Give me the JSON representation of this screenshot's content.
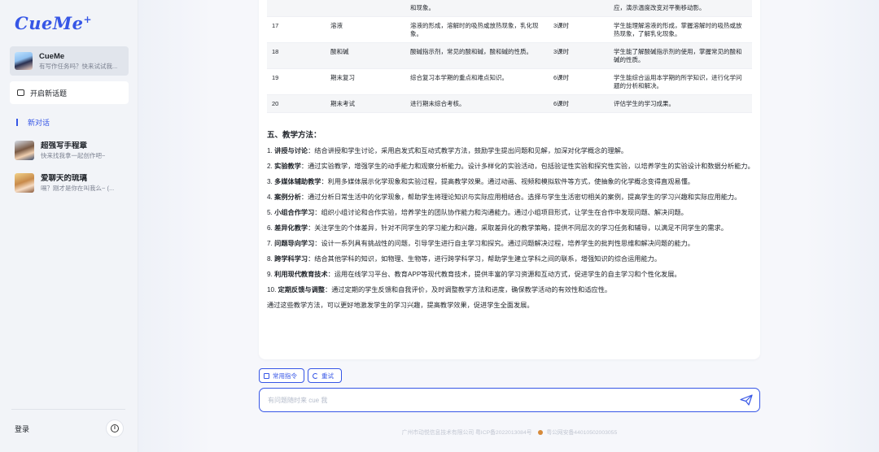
{
  "sidebar": {
    "logo": "CueMe",
    "bot_card": {
      "title": "CueMe",
      "subtitle": "有写作任务吗？快来试试我..."
    },
    "new_topic_label": "开启新话题",
    "new_chat_label": "新对话",
    "history": [
      {
        "title": "超强写手程章",
        "subtitle": "快来找我拿一起创作吧~"
      },
      {
        "title": "爱聊天的琉璃",
        "subtitle": "嗝？刚才是你在叫我么~ (..."
      }
    ],
    "login_label": "登录"
  },
  "table": {
    "partial_row": {
      "c3": "和现象。",
      "c5": "应，演示温度改变对平衡移动影。"
    },
    "rows": [
      {
        "no": "17",
        "topic": "溶液",
        "content": "溶液的形成，溶解时的吸热或放热现象，乳化现象。",
        "hours": "3课时",
        "goal": "学生能理解溶液的形成，掌握溶解时的吸热或放热现象，了解乳化现象。"
      },
      {
        "no": "18",
        "topic": "酸和碱",
        "content": "酸碱指示剂，常见的酸和碱，酸和碱的性质。",
        "hours": "3课时",
        "goal": "学生能了解酸碱指示剂的使用，掌握常见的酸和碱的性质。"
      },
      {
        "no": "19",
        "topic": "期末复习",
        "content": "综合复习本学期的重点和难点知识。",
        "hours": "6课时",
        "goal": "学生能综合运用本学期的所学知识，进行化学问题的分析和解决。"
      },
      {
        "no": "20",
        "topic": "期末考试",
        "content": "进行期末综合考核。",
        "hours": "6课时",
        "goal": "评估学生的学习成果。"
      }
    ]
  },
  "methods": {
    "section_title": "五、教学方法：",
    "items": [
      {
        "num": "1.",
        "title": "讲授与讨论",
        "body": "：结合讲授和学生讨论，采用启发式和互动式教学方法，鼓励学生提出问题和见解，加深对化学概念的理解。"
      },
      {
        "num": "2.",
        "title": "实验教学",
        "body": "：通过实验教学，增强学生的动手能力和观察分析能力。设计多样化的实验活动，包括验证性实验和探究性实验，以培养学生的实验设计和数据分析能力。"
      },
      {
        "num": "3.",
        "title": "多媒体辅助教学",
        "body": "：利用多媒体展示化学现象和实验过程，提高教学效果。通过动画、视频和模拟软件等方式，使抽象的化学概念变得直观易懂。"
      },
      {
        "num": "4.",
        "title": "案例分析",
        "body": "：通过分析日常生活中的化学现象，帮助学生将理论知识与实际应用相结合。选择与学生生活密切相关的案例，提高学生的学习兴趣和实际应用能力。"
      },
      {
        "num": "5.",
        "title": "小组合作学习",
        "body": "：组织小组讨论和合作实验，培养学生的团队协作能力和沟通能力。通过小组项目形式，让学生在合作中发现问题、解决问题。"
      },
      {
        "num": "6.",
        "title": "差异化教学",
        "body": "：关注学生的个体差异，针对不同学生的学习能力和兴趣，采取差异化的教学策略，提供不同层次的学习任务和辅导，以满足不同学生的需求。"
      },
      {
        "num": "7.",
        "title": "问题导向学习",
        "body": "：设计一系列具有挑战性的问题，引导学生进行自主学习和探究。通过问题解决过程，培养学生的批判性思维和解决问题的能力。"
      },
      {
        "num": "8.",
        "title": "跨学科学习",
        "body": "：结合其他学科的知识，如物理、生物等，进行跨学科学习，帮助学生建立学科之间的联系，增强知识的综合运用能力。"
      },
      {
        "num": "9.",
        "title": "利用现代教育技术",
        "body": "：运用在线学习平台、教育APP等现代教育技术，提供丰富的学习资源和互动方式，促进学生的自主学习和个性化发展。"
      },
      {
        "num": "10.",
        "title": "定期反馈与调整",
        "body": "：通过定期的学生反馈和自我评价，及时调整教学方法和进度，确保教学活动的有效性和适应性。"
      }
    ],
    "summary": "通过这些教学方法，可以更好地激发学生的学习兴趣，提高教学效果，促进学生全面发展。"
  },
  "toolbar": {
    "commands_label": "常用指令",
    "retry_label": "重试"
  },
  "input": {
    "placeholder": "有问题随时来 cue 我",
    "value": ""
  },
  "footer": {
    "company": "广州市动悦信息技术有限公司 粤ICP备2022013084号",
    "police": "粤公网安备44010502003055"
  },
  "colors": {
    "accent": "#3656e6",
    "sidebar_bg": "#f2f4f8"
  }
}
